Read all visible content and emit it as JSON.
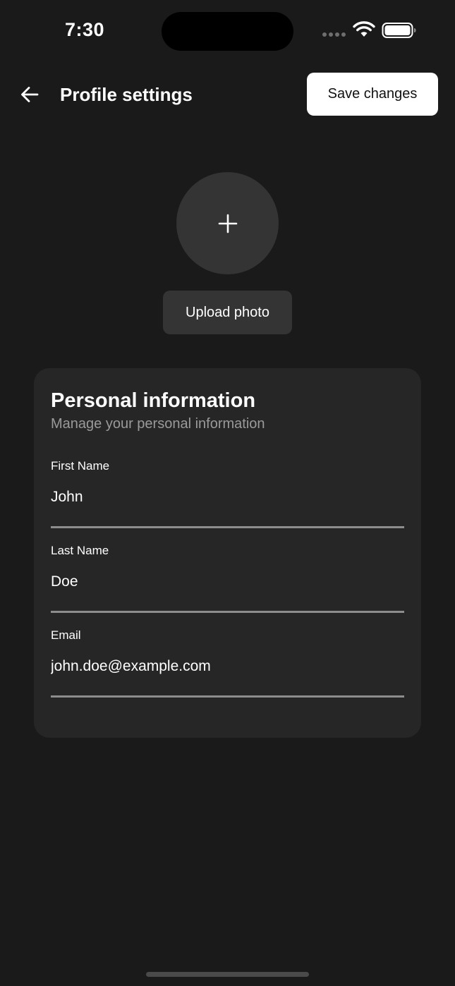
{
  "status_bar": {
    "time": "7:30"
  },
  "header": {
    "back_icon": "arrow-left-icon",
    "title": "Profile settings",
    "save_label": "Save changes"
  },
  "photo": {
    "add_icon": "plus-icon",
    "upload_label": "Upload photo"
  },
  "personal_info": {
    "title": "Personal information",
    "subtitle": "Manage your personal information",
    "fields": [
      {
        "label": "First Name",
        "value": "John"
      },
      {
        "label": "Last Name",
        "value": "Doe"
      },
      {
        "label": "Email",
        "value": "john.doe@example.com"
      }
    ]
  },
  "colors": {
    "background": "#1a1a1a",
    "card": "#262626",
    "avatar": "#343434",
    "primary_button": "#ffffff",
    "underline": "#8d8d8d",
    "muted_text": "#9a9a9a"
  }
}
